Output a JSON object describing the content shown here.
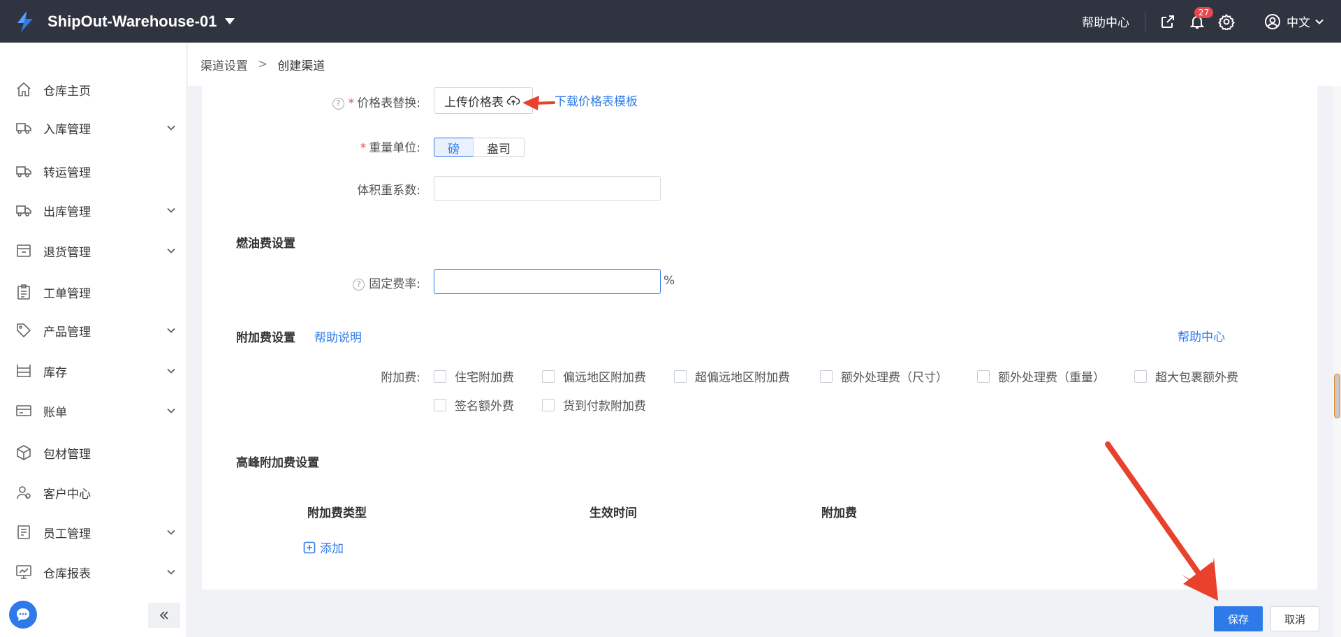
{
  "header": {
    "app_title": "ShipOut-Warehouse-01",
    "help_center": "帮助中心",
    "notification_count": "27",
    "language": "中文"
  },
  "sidebar": {
    "items": [
      {
        "label": "仓库主页",
        "icon": "home-icon",
        "expandable": false
      },
      {
        "label": "入库管理",
        "icon": "inbound-truck-icon",
        "expandable": true
      },
      {
        "label": "转运管理",
        "icon": "transfer-truck-icon",
        "expandable": false
      },
      {
        "label": "出库管理",
        "icon": "outbound-truck-icon",
        "expandable": true
      },
      {
        "label": "退货管理",
        "icon": "return-box-icon",
        "expandable": true
      },
      {
        "label": "工单管理",
        "icon": "clipboard-icon",
        "expandable": false
      },
      {
        "label": "产品管理",
        "icon": "tag-icon",
        "expandable": true
      },
      {
        "label": "库存",
        "icon": "shelf-icon",
        "expandable": true
      },
      {
        "label": "账单",
        "icon": "bill-icon",
        "expandable": true
      },
      {
        "label": "包材管理",
        "icon": "package-icon",
        "expandable": false
      },
      {
        "label": "客户中心",
        "icon": "customer-icon",
        "expandable": false
      },
      {
        "label": "员工管理",
        "icon": "staff-icon",
        "expandable": true
      },
      {
        "label": "仓库报表",
        "icon": "report-icon",
        "expandable": true
      }
    ]
  },
  "breadcrumb": {
    "parent": "渠道设置",
    "separator": ">",
    "current": "创建渠道"
  },
  "form": {
    "price_table_label": "价格表替换:",
    "upload_button": "上传价格表",
    "download_template": "下载价格表模板",
    "weight_unit_label": "重量单位:",
    "weight_unit_options": [
      "磅",
      "盎司"
    ],
    "weight_unit_selected": "磅",
    "volume_factor_label": "体积重系数:",
    "volume_factor_value": "",
    "fuel_section_title": "燃油费设置",
    "fixed_rate_label": "固定费率:",
    "fixed_rate_value": "",
    "fixed_rate_unit": "%",
    "surcharge_section_title": "附加费设置",
    "surcharge_help_link": "帮助说明",
    "help_center_link": "帮助中心",
    "surcharge_label": "附加费:",
    "surcharges": [
      "住宅附加费",
      "偏远地区附加费",
      "超偏远地区附加费",
      "额外处理费（尺寸）",
      "额外处理费（重量）",
      "超大包裹额外费",
      "签名额外费",
      "货到付款附加费"
    ],
    "peak_section_title": "高峰附加费设置",
    "peak_table_headers": [
      "附加费类型",
      "生效时间",
      "附加费"
    ],
    "add_button": "添加"
  },
  "footer": {
    "save": "保存",
    "cancel": "取消"
  },
  "colors": {
    "topbar": "#2f3440",
    "accent": "#2d7ae8",
    "annotation_arrow": "#e8412c"
  }
}
